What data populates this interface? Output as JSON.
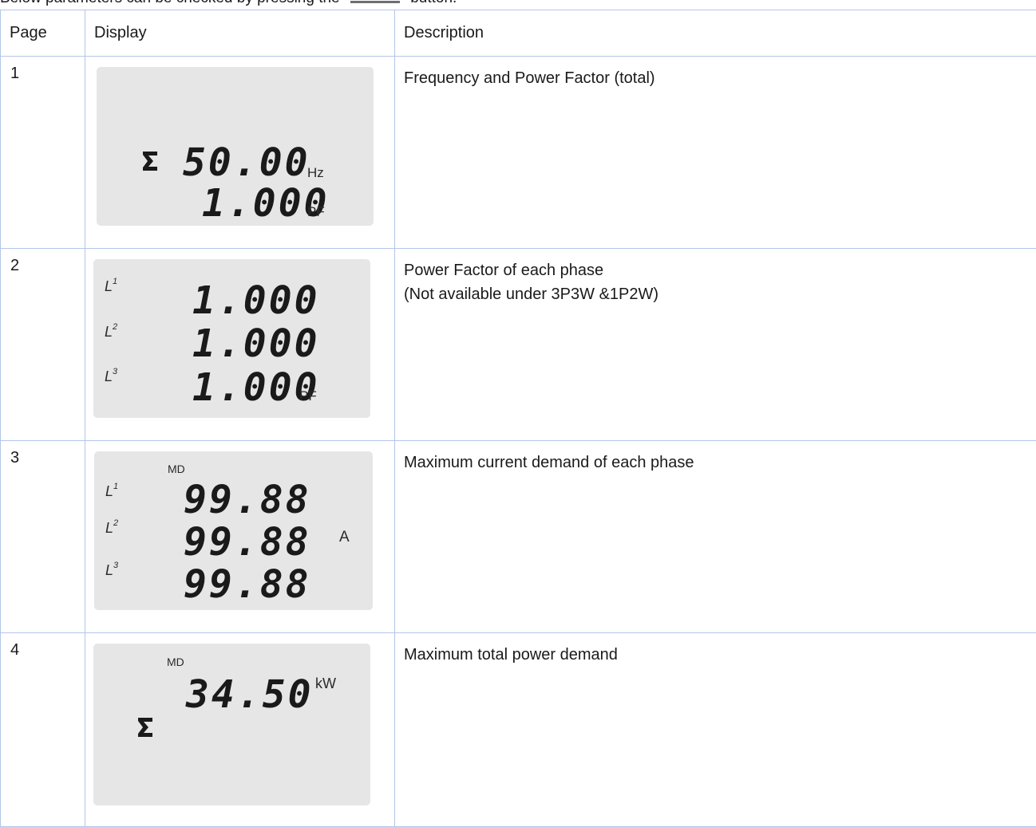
{
  "intro": {
    "before": "Below parameters can be checked by pressing the",
    "after": "button."
  },
  "table": {
    "headers": {
      "page": "Page",
      "display": "Display",
      "description": "Description"
    },
    "rows": [
      {
        "page": "1",
        "description": "Frequency and Power Factor (total)",
        "lcd": {
          "sigma_icon": "sigma-icon",
          "line1": "50.00",
          "unit1": "Hz",
          "line2": "1.000",
          "unit2": "PF"
        }
      },
      {
        "page": "2",
        "description": "Power Factor of each phase",
        "description_note": "(Not available under 3P3W &1P2W)",
        "lcd": {
          "phase_l1": "L",
          "phase_l2": "L",
          "phase_l3": "L",
          "sup1": "1",
          "sup2": "2",
          "sup3": "3",
          "line1": "1.000",
          "line2": "1.000",
          "line3": "1.000",
          "unit": "PF"
        }
      },
      {
        "page": "3",
        "description": "Maximum current demand of each phase",
        "lcd": {
          "tag": "MD",
          "phase_l1": "L",
          "phase_l2": "L",
          "phase_l3": "L",
          "sup1": "1",
          "sup2": "2",
          "sup3": "3",
          "line1": "99.88",
          "line2": "99.88",
          "line3": "99.88",
          "unit": "A"
        }
      },
      {
        "page": "4",
        "description": "Maximum total power demand",
        "lcd": {
          "tag": "MD",
          "line1": "34.50",
          "unit": "kW",
          "sigma_icon": "sigma-icon"
        }
      }
    ]
  }
}
